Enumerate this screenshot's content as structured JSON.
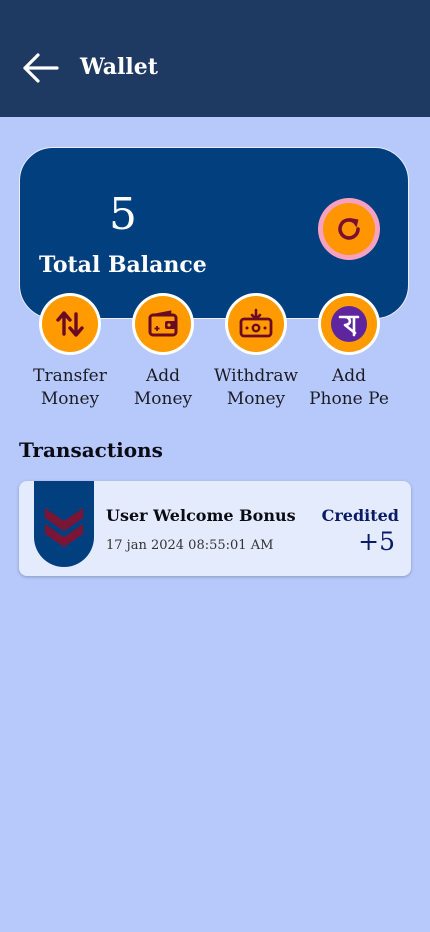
{
  "header": {
    "title": "Wallet",
    "back_icon": "arrow-left-icon",
    "background": "#1e3a62"
  },
  "balance": {
    "amount": "5",
    "label": "Total Balance",
    "refresh_icon": "refresh-icon",
    "card_color": "#013f7f"
  },
  "actions": [
    {
      "icon": "swap-vertical-icon",
      "line1": "Transfer",
      "line2": "Money"
    },
    {
      "icon": "wallet-add-icon",
      "line1": "Add",
      "line2": "Money"
    },
    {
      "icon": "cash-withdraw-icon",
      "line1": "Withdraw",
      "line2": "Money"
    },
    {
      "icon": "phonepe-icon",
      "line1": "Add",
      "line2": "Phone Pe"
    }
  ],
  "accent": "#ff9a00",
  "transactions": {
    "title": "Transactions",
    "items": [
      {
        "name": "User Welcome Bonus",
        "time": "17 jan 2024 08:55:01 AM",
        "status": "Credited",
        "amount": "+5",
        "icon": "double-chevron-down-icon"
      }
    ]
  }
}
